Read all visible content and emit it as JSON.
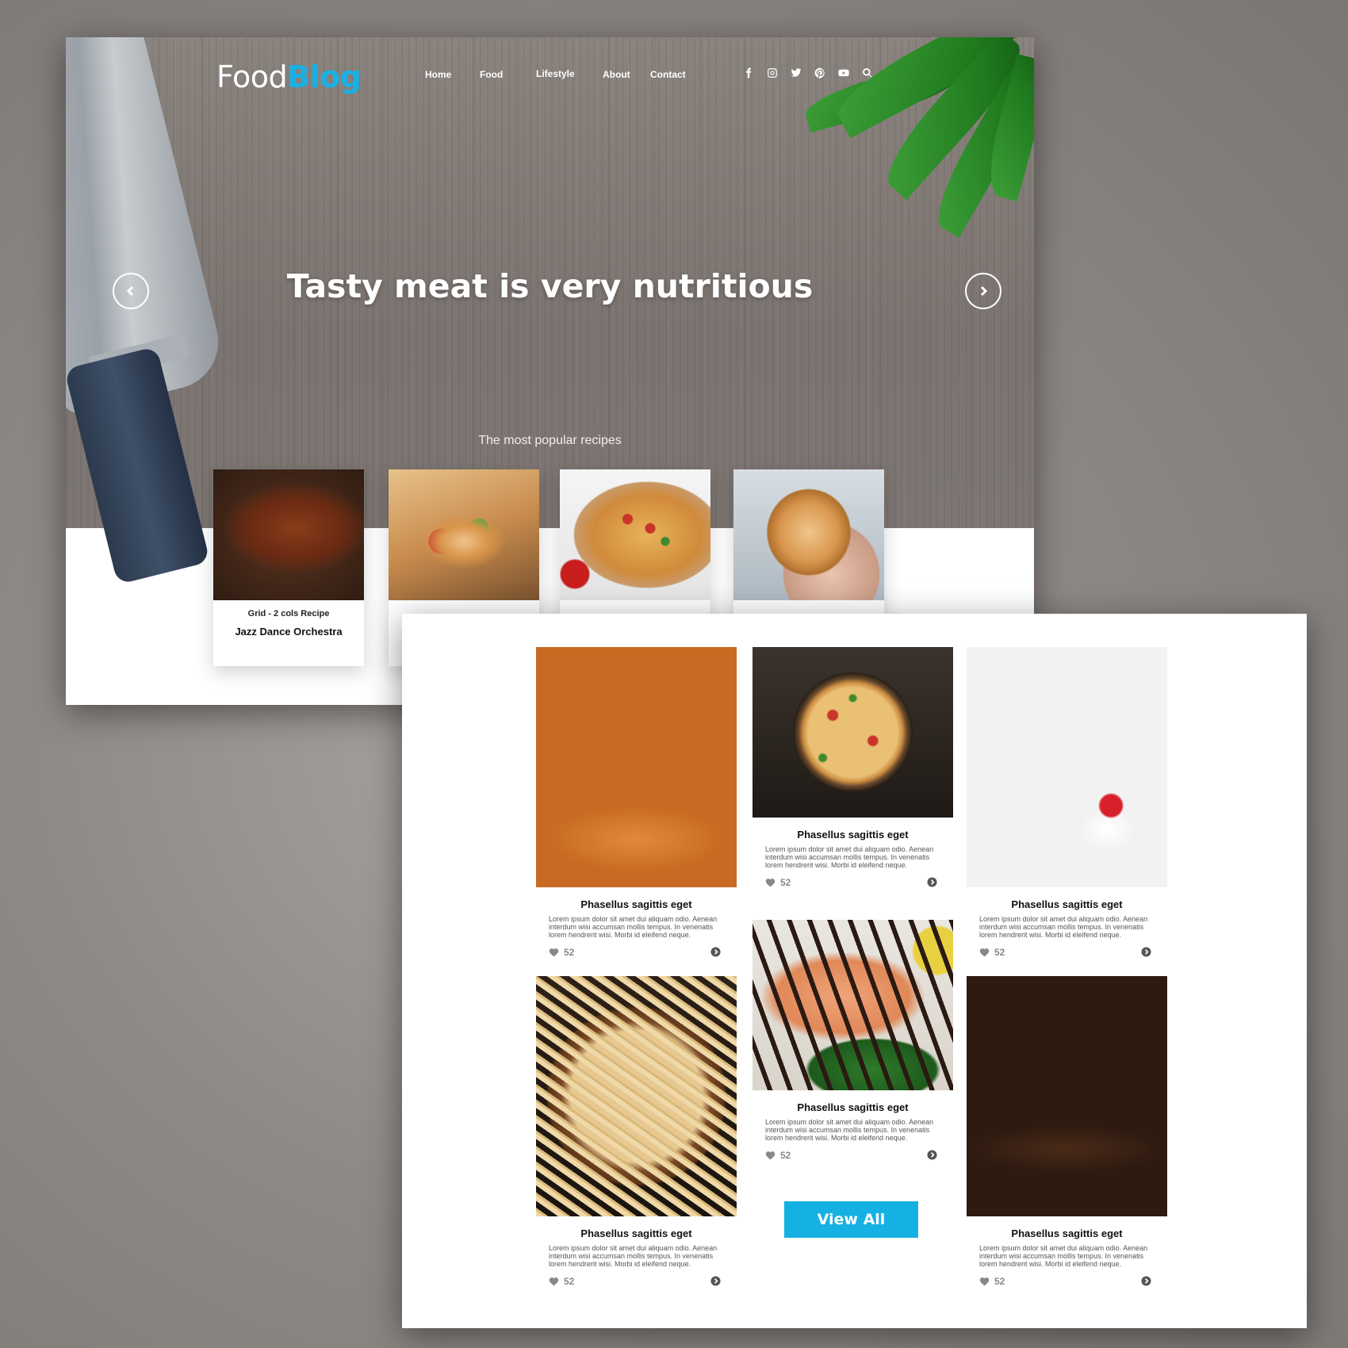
{
  "brand": {
    "logo_part1": "Food",
    "logo_part2": "Blog",
    "accent_color": "#1ab0e6"
  },
  "nav": {
    "items": [
      {
        "label": "Home"
      },
      {
        "label": "Food"
      },
      {
        "label": "Lifestyle"
      },
      {
        "label": "About"
      },
      {
        "label": "Contact"
      }
    ],
    "social_icons": [
      "facebook-icon",
      "instagram-icon",
      "twitter-icon",
      "pinterest-icon",
      "youtube-icon",
      "search-icon"
    ]
  },
  "hero": {
    "title": "Tasty meat is very nutritious",
    "popular_label": "The most popular recipes"
  },
  "popular_cards": [
    {
      "category": "Grid - 2 cols Recipe",
      "title": "Jazz Dance Orchestra",
      "image": "ribs"
    },
    {
      "category": "",
      "title": "",
      "image": "burrito"
    },
    {
      "category": "",
      "title": "",
      "image": "pizza"
    },
    {
      "category": "",
      "title": "",
      "image": "cat-toast"
    }
  ],
  "posts": [
    {
      "title": "Phasellus sagittis eget",
      "text": "Lorem ipsum dolor sit amet dui aliquam odio. Aenean interdum wisi accumsan mollis tempus. In venenatis lorem hendrerit wisi. Morbi id eleifend neque.",
      "likes": "52",
      "image": "burger"
    },
    {
      "title": "Phasellus sagittis eget",
      "text": "Lorem ipsum dolor sit amet dui aliquam odio. Aenean interdum wisi accumsan mollis tempus. In venenatis lorem hendrerit wisi. Morbi id eleifend neque.",
      "likes": "52",
      "image": "pizza"
    },
    {
      "title": "Phasellus sagittis eget",
      "text": "Lorem ipsum dolor sit amet dui aliquam odio. Aenean interdum wisi accumsan mollis tempus. In venenatis lorem hendrerit wisi. Morbi id eleifend neque.",
      "likes": "52",
      "image": "cake"
    },
    {
      "title": "Phasellus sagittis eget",
      "text": "Lorem ipsum dolor sit amet dui aliquam odio. Aenean interdum wisi accumsan mollis tempus. In venenatis lorem hendrerit wisi. Morbi id eleifend neque.",
      "likes": "52",
      "image": "pasta"
    },
    {
      "title": "Phasellus sagittis eget",
      "text": "Lorem ipsum dolor sit amet dui aliquam odio. Aenean interdum wisi accumsan mollis tempus. In venenatis lorem hendrerit wisi. Morbi id eleifend neque.",
      "likes": "52",
      "image": "salmon"
    },
    {
      "title": "Phasellus sagittis eget",
      "text": "Lorem ipsum dolor sit amet dui aliquam odio. Aenean interdum wisi accumsan mollis tempus. In venenatis lorem hendrerit wisi. Morbi id eleifend neque.",
      "likes": "52",
      "image": "burger"
    }
  ],
  "view_all_label": "View All"
}
